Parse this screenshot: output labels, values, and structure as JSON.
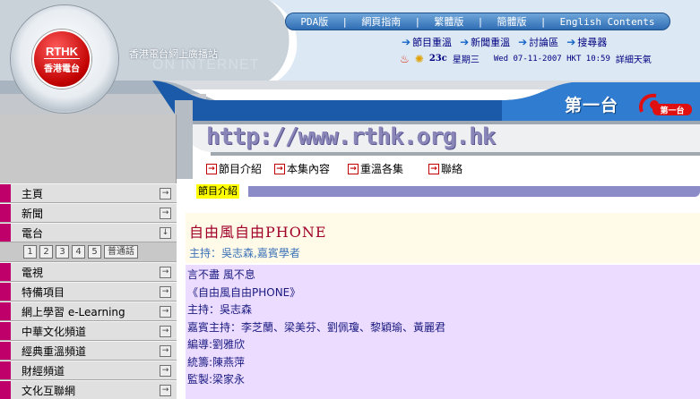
{
  "header": {
    "logo_line1": "RTHK",
    "logo_line2": "香港電台",
    "tagline": "香港電台網上廣播站",
    "ghost_text": "ON INTERNET",
    "top_nav": [
      "PDA版",
      "網頁指南",
      "繁體版",
      "簡體版",
      "English Contents"
    ],
    "sub_nav": [
      "節目重溫",
      "新聞重溫",
      "討論區",
      "搜尋器"
    ],
    "status": {
      "temperature": "23c",
      "weekday": "星期三",
      "datetime": "Wed 07-11-2007  HKT 10:59",
      "weather_link": "詳細天氣"
    },
    "channel_name": "第一台",
    "channel_logo_text": "第一台",
    "url_banner": "http://www.rthk.org.hk",
    "page_nav": [
      "節目介紹",
      "本集內容",
      "重溫各集",
      "聯絡"
    ]
  },
  "sidebar": {
    "items": [
      {
        "label": "主頁",
        "arrow": "→"
      },
      {
        "label": "新聞",
        "arrow": "→"
      },
      {
        "label": "電台",
        "arrow": "↓"
      },
      {
        "label": "電視",
        "arrow": "→"
      },
      {
        "label": "特備項目",
        "arrow": "→"
      },
      {
        "label": "網上學習 e-Learning",
        "arrow": "→"
      },
      {
        "label": "中華文化頻道",
        "arrow": "→"
      },
      {
        "label": "經典重溫頻道",
        "arrow": "→"
      },
      {
        "label": "財經頻道",
        "arrow": "→"
      },
      {
        "label": "文化互聯網",
        "arrow": "→"
      }
    ],
    "radio_channels": [
      "1",
      "2",
      "3",
      "4",
      "5",
      "普通話"
    ]
  },
  "content": {
    "section_label": "節目介紹",
    "program_title": "自由風自由PHONE",
    "program_host": "主持：吳志森,嘉賓學者",
    "description_lines": [
      "言不盡  風不息",
      "《自由風自由PHONE》",
      "主持：吳志森",
      "嘉賓主持：李芝蘭、梁美芬、劉佩瓊、黎穎瑜、黃麗君",
      "編導:劉雅欣",
      "統籌:陳燕萍",
      "監製:梁家永"
    ]
  }
}
